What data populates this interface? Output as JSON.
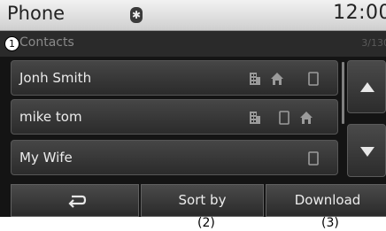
{
  "header": {
    "title": "Phone",
    "clock": "12:00",
    "bluetooth_icon": "bluetooth-icon"
  },
  "list_header": {
    "label": "Contacts",
    "count": "3/130",
    "callout": "1"
  },
  "contacts": [
    {
      "name": "Jonh Smith",
      "icons": [
        "office-icon",
        "home-icon",
        "mobile-icon"
      ]
    },
    {
      "name": "mike tom",
      "icons": [
        "office-icon",
        "mobile-icon",
        "home-icon"
      ]
    },
    {
      "name": "My Wife",
      "icons": [
        "mobile-icon"
      ]
    }
  ],
  "buttons": {
    "back_icon": "back-arrow-icon",
    "sort": "Sort by",
    "download": "Download"
  },
  "callouts": {
    "sort": "(2)",
    "download": "(3)"
  },
  "colors": {
    "background": "#141414",
    "status_bar": "#e6e6e6",
    "text": "#ececec"
  }
}
